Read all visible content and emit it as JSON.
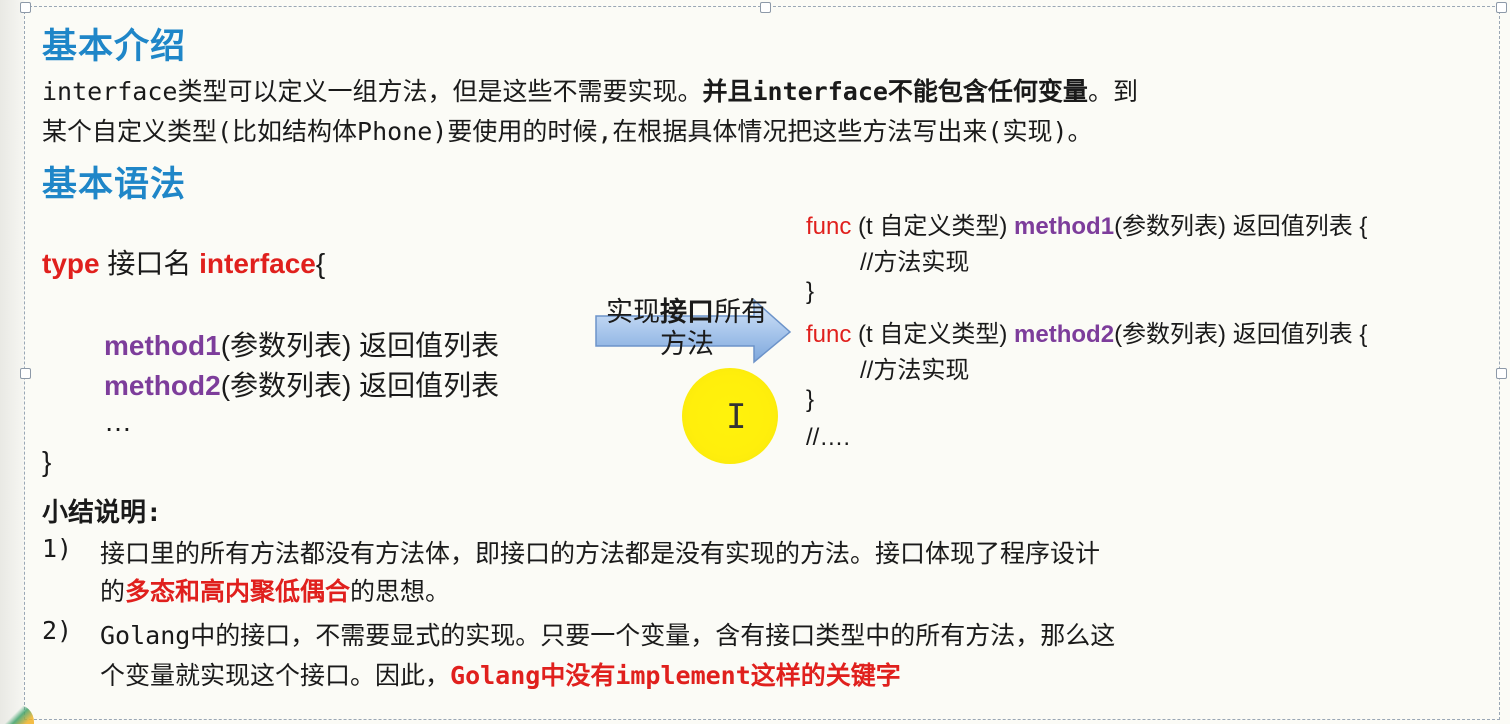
{
  "section1": {
    "heading": "基本介绍",
    "line1_a": "interface类型可以定义一组方法，但是这些不需要实现。",
    "line1_b": "并且interface不能包含任何变量",
    "line1_c": "。到",
    "line2": "某个自定义类型(比如结构体Phone)要使用的时候,在根据具体情况把这些方法写出来(实现)。"
  },
  "section2": {
    "heading": "基本语法"
  },
  "code_left": {
    "kw_type": "type",
    "iface_name": "接口名",
    "kw_interface": "interface",
    "open_brace": "{",
    "m1_name": "method1",
    "m1_rest": "(参数列表) 返回值列表",
    "m2_name": "method2",
    "m2_rest": "(参数列表) 返回值列表",
    "ellipsis": "…",
    "close_brace": "}"
  },
  "arrow": {
    "label_a": "实现",
    "label_b": "接口",
    "label_c": "所有方法"
  },
  "code_right": {
    "kw_func": "func",
    "recv": "(t 自定义类型)",
    "m1_name": "method1",
    "m2_name": "method2",
    "sig_rest": "(参数列表) 返回值列表 {",
    "body_comment": "//方法实现",
    "close_brace": "}",
    "tail_comment": "//…."
  },
  "summary": {
    "title": "小结说明:",
    "item1_num": "1)",
    "item1_line1": "接口里的所有方法都没有方法体，即接口的方法都是没有实现的方法。接口体现了程序设计",
    "item1_line2_a": "的",
    "item1_line2_b": "多态和高内聚低偶合",
    "item1_line2_c": "的思想。",
    "item2_num": "2)",
    "item2_line1": "Golang中的接口，不需要显式的实现。只要一个变量，含有接口类型中的所有方法，那么这",
    "item2_line2_a": "个变量就实现这个接口。因此，",
    "item2_line2_b": "Golang中没有implement这样的关键字"
  },
  "colors": {
    "heading_blue": "#1f86c8",
    "keyword_red": "#e0201d",
    "method_purple": "#7d3d9b",
    "arrow_fill": "#a9c7ec",
    "cursor_highlight": "#fff200"
  },
  "icons": {
    "arrow": "right-arrow-shape",
    "cursor": "text-ibeam-cursor"
  }
}
